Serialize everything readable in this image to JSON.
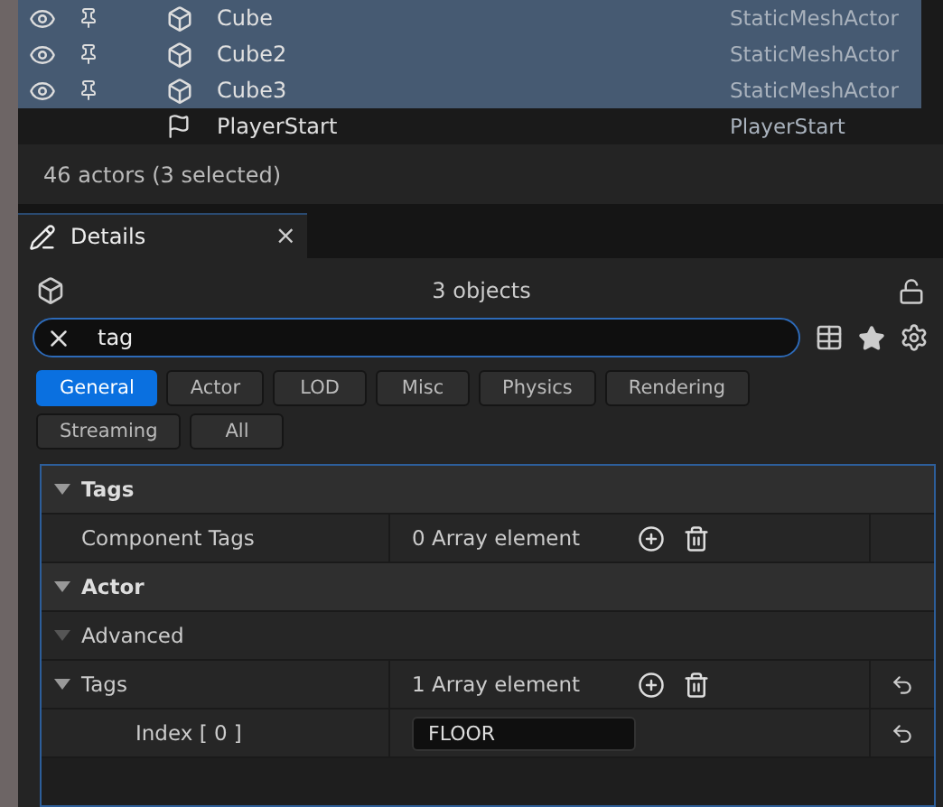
{
  "outliner": {
    "rows": [
      {
        "label": "Cube",
        "type": "StaticMeshActor",
        "kind": "mesh",
        "selected": true
      },
      {
        "label": "Cube2",
        "type": "StaticMeshActor",
        "kind": "mesh",
        "selected": true
      },
      {
        "label": "Cube3",
        "type": "StaticMeshActor",
        "kind": "mesh",
        "selected": true
      },
      {
        "label": "PlayerStart",
        "type": "PlayerStart",
        "kind": "start",
        "selected": false
      }
    ],
    "status": "46 actors (3 selected)"
  },
  "details": {
    "tab": {
      "title": "Details",
      "close": "×"
    },
    "header": "3 objects",
    "search": {
      "value": "tag"
    },
    "filters": [
      {
        "label": "General",
        "selected": true
      },
      {
        "label": "Actor",
        "selected": false
      },
      {
        "label": "LOD",
        "selected": false
      },
      {
        "label": "Misc",
        "selected": false
      },
      {
        "label": "Physics",
        "selected": false
      },
      {
        "label": "Rendering",
        "selected": false
      },
      {
        "label": "Streaming",
        "selected": false
      },
      {
        "label": "All",
        "selected": false
      }
    ],
    "sections": [
      {
        "title": "Tags",
        "expanded": true,
        "rows": [
          {
            "kind": "array",
            "label": "Component Tags",
            "value": "0 Array element",
            "reset": false
          }
        ]
      },
      {
        "title": "Actor",
        "expanded": true,
        "rows": [
          {
            "kind": "group",
            "label": "Advanced",
            "expanded": true
          },
          {
            "kind": "array",
            "label": "Tags",
            "value": "1 Array element",
            "reset": true,
            "expanded": true,
            "children": [
              {
                "kind": "text",
                "label": "Index [ 0 ]",
                "value": "FLOOR",
                "reset": true
              }
            ]
          }
        ]
      }
    ]
  }
}
